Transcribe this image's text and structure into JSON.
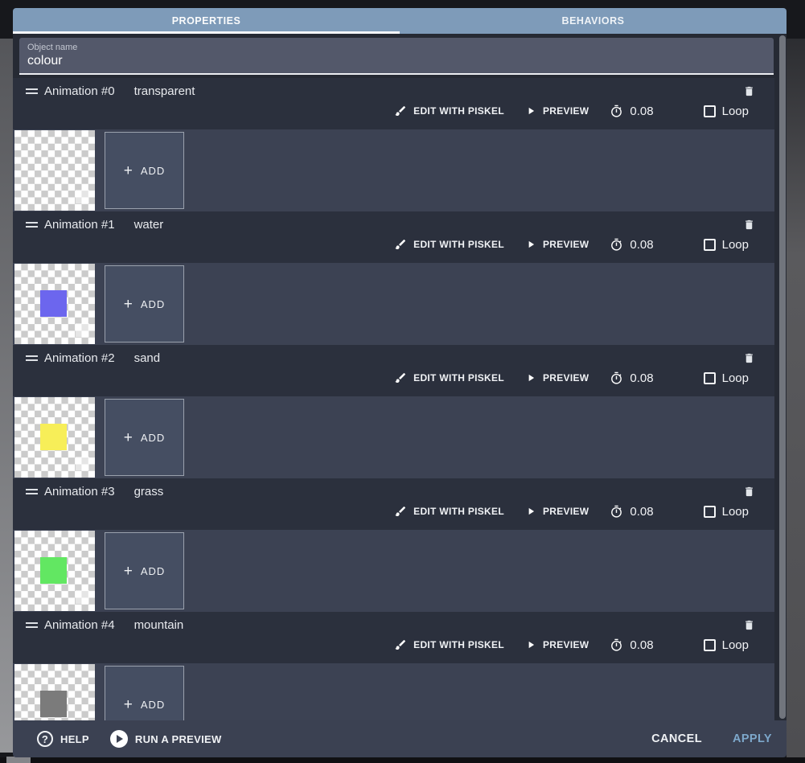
{
  "tabs": [
    {
      "label": "PROPERTIES",
      "active": true
    },
    {
      "label": "BEHAVIORS",
      "active": false
    }
  ],
  "object_name": {
    "label": "Object name",
    "value": "colour"
  },
  "controls": {
    "edit_label": "EDIT WITH PISKEL",
    "preview_label": "PREVIEW",
    "loop_label": "Loop",
    "add_label": "ADD",
    "add_plus": "+"
  },
  "animations": [
    {
      "title": "Animation #0",
      "name": "transparent",
      "time": "0.08",
      "loop_checked": false,
      "frame_color": null
    },
    {
      "title": "Animation #1",
      "name": "water",
      "time": "0.08",
      "loop_checked": false,
      "frame_color": "#6c66ee"
    },
    {
      "title": "Animation #2",
      "name": "sand",
      "time": "0.08",
      "loop_checked": false,
      "frame_color": "#f7ee58"
    },
    {
      "title": "Animation #3",
      "name": "grass",
      "time": "0.08",
      "loop_checked": false,
      "frame_color": "#62e762"
    },
    {
      "title": "Animation #4",
      "name": "mountain",
      "time": "0.08",
      "loop_checked": false,
      "frame_color": "#7b7b7b"
    }
  ],
  "footer": {
    "help": "HELP",
    "run": "RUN A PREVIEW",
    "cancel": "CANCEL",
    "apply": "APPLY",
    "help_glyph": "?"
  },
  "colors": {
    "tab_bar": "#7e9bb9",
    "section_header": "#2b303d",
    "frames_strip": "#3c4253",
    "footer_bar": "#3b4152",
    "apply_text": "#7da8cb",
    "checker_light": "#ffffff",
    "checker_dark": "#cbcbcb"
  },
  "icons": {
    "drag": "drag-handle-icon",
    "delete": "trash-icon",
    "edit": "brush-icon",
    "preview": "play-icon",
    "time": "stopwatch-icon",
    "loop": "checkbox-icon",
    "help": "question-circle-icon",
    "run": "play-circle-icon"
  }
}
